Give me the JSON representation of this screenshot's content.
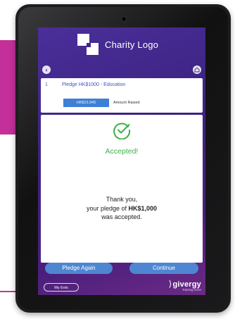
{
  "header": {
    "logo_text": "Charity Logo",
    "back_icon": "chevron-left-icon",
    "home_icon": "home-icon"
  },
  "pledge": {
    "number": "1",
    "title": "Pledge HK$1000 - Education",
    "raised_value": "HK$15,945",
    "raised_label": "Amount Raised"
  },
  "result": {
    "status_icon": "check-circle-icon",
    "status_text": "Accepted!",
    "line1": "Thank you,",
    "line2_prefix": "your pledge of ",
    "amount": "HK$1,000",
    "line3": "was accepted."
  },
  "actions": {
    "pledge_again": "Pledge Again",
    "continue": "Continue"
  },
  "footer": {
    "my_events": "My Evts",
    "brand": "givergy",
    "tagline": "Raising more"
  },
  "colors": {
    "screen_bg": "#3c2380",
    "accent_blue": "#4f86d2",
    "success_green": "#3cb049",
    "magenta": "#c4309a"
  }
}
